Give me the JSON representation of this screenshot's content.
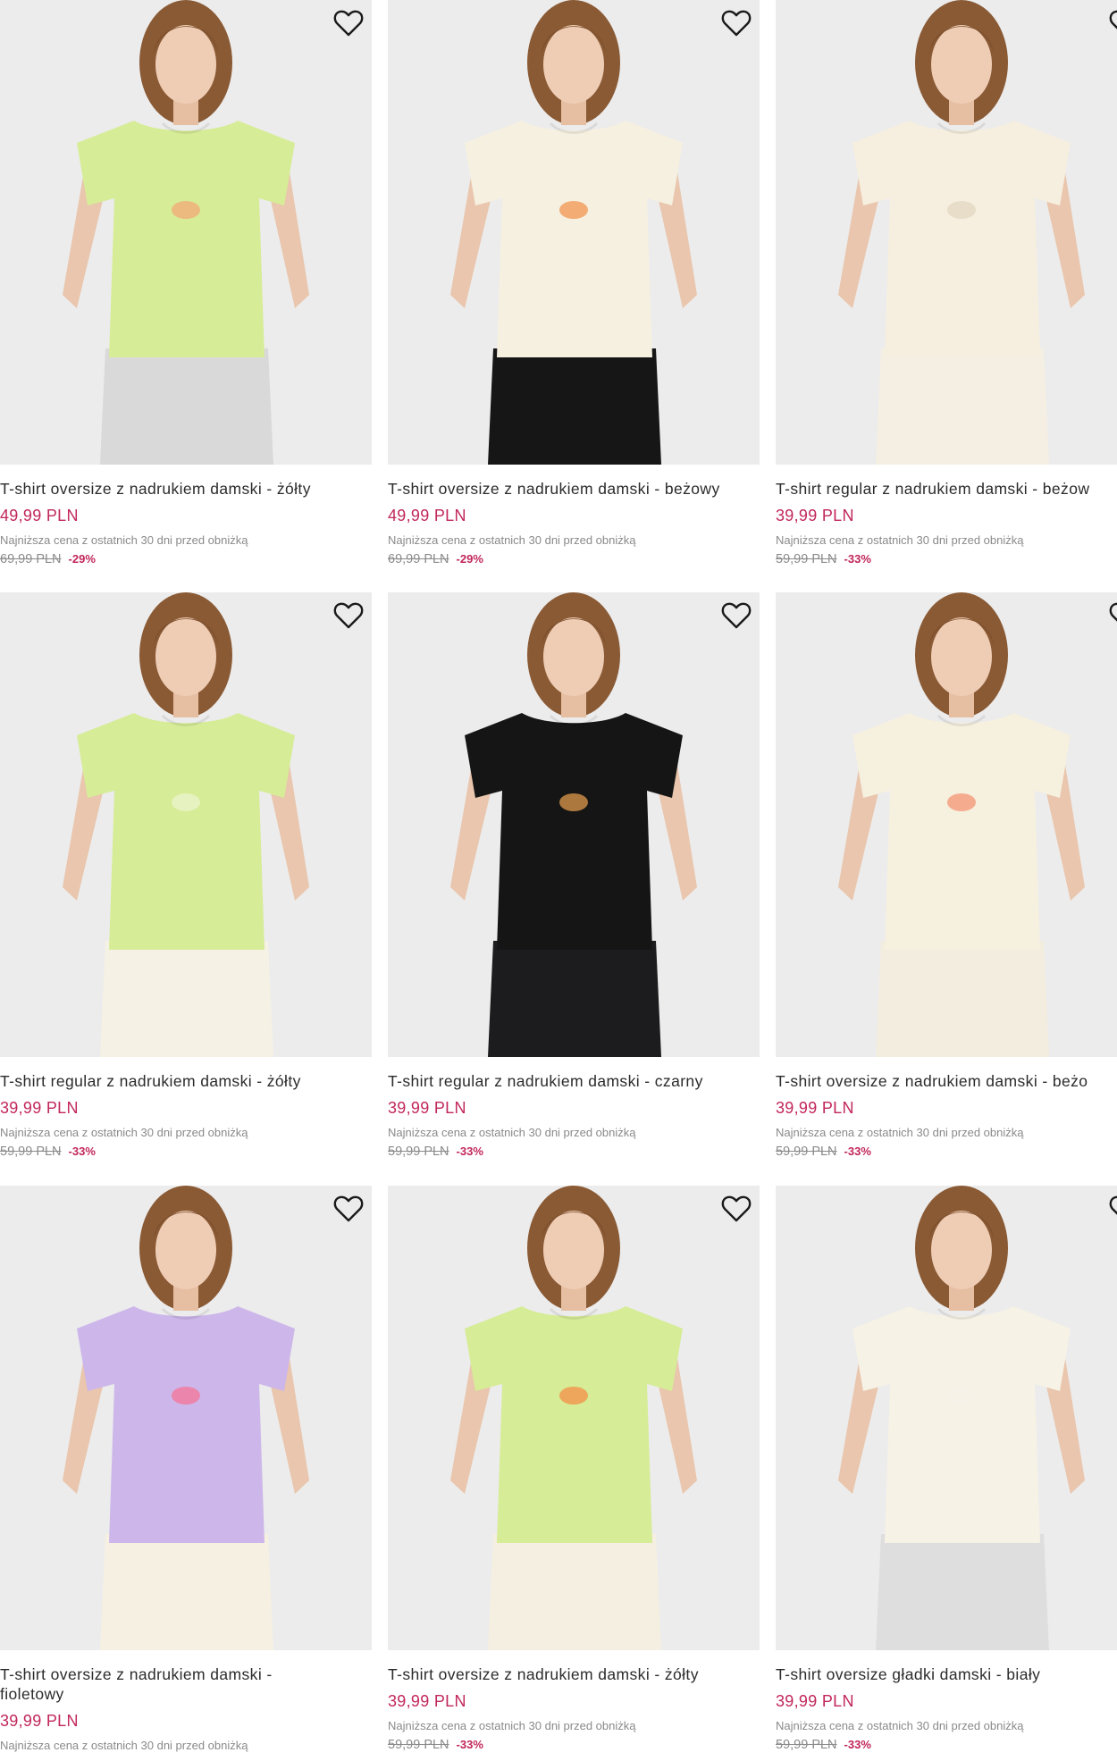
{
  "colors": {
    "accent": "#c1275a",
    "card_bg": "#ededed",
    "muted": "#8a8a8a"
  },
  "icons": {
    "wishlist": "heart-outline-icon"
  },
  "products": [
    {
      "title": "T-shirt oversize z nadrukiem damski - żółty",
      "price": "49,99 PLN",
      "lowest_note": "Najniższa cena z ostatnich 30 dni przed obniżką",
      "old_price": "69,99 PLN",
      "discount": "-29%",
      "shirt_color": "#d7ec97",
      "bottom_color": "#d9d9d9",
      "print_color": "#f0b07a"
    },
    {
      "title": "T-shirt oversize z nadrukiem damski - beżowy",
      "price": "49,99 PLN",
      "lowest_note": "Najniższa cena z ostatnich 30 dni przed obniżką",
      "old_price": "69,99 PLN",
      "discount": "-29%",
      "shirt_color": "#f6f0e0",
      "bottom_color": "#161616",
      "print_color": "#f1a060"
    },
    {
      "title": "T-shirt regular z nadrukiem damski - beżow",
      "price": "39,99 PLN",
      "lowest_note": "Najniższa cena z ostatnich 30 dni przed obniżką",
      "old_price": "59,99 PLN",
      "discount": "-33%",
      "shirt_color": "#f6efdf",
      "bottom_color": "#f4efe2",
      "print_color": "#e4d9c5"
    },
    {
      "title": "T-shirt regular z nadrukiem damski - żółty",
      "price": "39,99 PLN",
      "lowest_note": "Najniższa cena z ostatnich 30 dni przed obniżką",
      "old_price": "59,99 PLN",
      "discount": "-33%",
      "shirt_color": "#d6ec97",
      "bottom_color": "#f5f1e4",
      "print_color": "#e9f3c6"
    },
    {
      "title": "T-shirt regular z nadrukiem damski - czarny",
      "price": "39,99 PLN",
      "lowest_note": "Najniższa cena z ostatnich 30 dni przed obniżką",
      "old_price": "59,99 PLN",
      "discount": "-33%",
      "shirt_color": "#151515",
      "bottom_color": "#1c1c1e",
      "print_color": "#c88a45"
    },
    {
      "title": "T-shirt oversize z nadrukiem damski - beżo",
      "price": "39,99 PLN",
      "lowest_note": "Najniższa cena z ostatnich 30 dni przed obniżką",
      "old_price": "59,99 PLN",
      "discount": "-33%",
      "shirt_color": "#f6f0df",
      "bottom_color": "#f3eddf",
      "print_color": "#f4a080"
    },
    {
      "title": "T-shirt oversize z nadrukiem damski - fioletowy",
      "price": "39,99 PLN",
      "lowest_note": "Najniższa cena z ostatnich 30 dni przed obniżką",
      "old_price": "",
      "discount": "",
      "shirt_color": "#cdb7ea",
      "bottom_color": "#f5f0e2",
      "print_color": "#f07ca0"
    },
    {
      "title": "T-shirt oversize z nadrukiem damski - żółty",
      "price": "39,99 PLN",
      "lowest_note": "Najniższa cena z ostatnich 30 dni przed obniżką",
      "old_price": "59,99 PLN",
      "discount": "-33%",
      "shirt_color": "#d6ec97",
      "bottom_color": "#f4efe1",
      "print_color": "#f19a50"
    },
    {
      "title": "T-shirt oversize gładki damski - biały",
      "price": "39,99 PLN",
      "lowest_note": "Najniższa cena z ostatnich 30 dni przed obniżką",
      "old_price": "59,99 PLN",
      "discount": "-33%",
      "shirt_color": "#f7f2e6",
      "bottom_color": "#dedede",
      "print_color": "#f7f2e6"
    }
  ]
}
